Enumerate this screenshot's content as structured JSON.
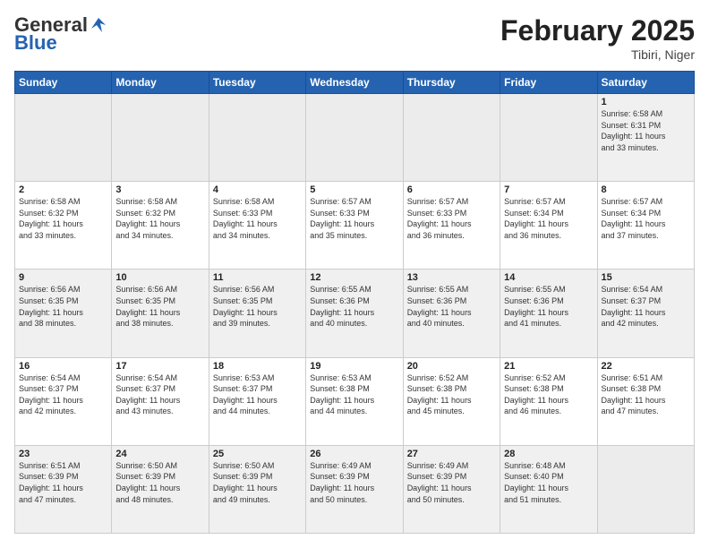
{
  "header": {
    "logo_line1": "General",
    "logo_line2": "Blue",
    "month": "February 2025",
    "location": "Tibiri, Niger"
  },
  "weekdays": [
    "Sunday",
    "Monday",
    "Tuesday",
    "Wednesday",
    "Thursday",
    "Friday",
    "Saturday"
  ],
  "weeks": [
    [
      {
        "day": "",
        "info": ""
      },
      {
        "day": "",
        "info": ""
      },
      {
        "day": "",
        "info": ""
      },
      {
        "day": "",
        "info": ""
      },
      {
        "day": "",
        "info": ""
      },
      {
        "day": "",
        "info": ""
      },
      {
        "day": "1",
        "info": "Sunrise: 6:58 AM\nSunset: 6:31 PM\nDaylight: 11 hours\nand 33 minutes."
      }
    ],
    [
      {
        "day": "2",
        "info": "Sunrise: 6:58 AM\nSunset: 6:32 PM\nDaylight: 11 hours\nand 33 minutes."
      },
      {
        "day": "3",
        "info": "Sunrise: 6:58 AM\nSunset: 6:32 PM\nDaylight: 11 hours\nand 34 minutes."
      },
      {
        "day": "4",
        "info": "Sunrise: 6:58 AM\nSunset: 6:33 PM\nDaylight: 11 hours\nand 34 minutes."
      },
      {
        "day": "5",
        "info": "Sunrise: 6:57 AM\nSunset: 6:33 PM\nDaylight: 11 hours\nand 35 minutes."
      },
      {
        "day": "6",
        "info": "Sunrise: 6:57 AM\nSunset: 6:33 PM\nDaylight: 11 hours\nand 36 minutes."
      },
      {
        "day": "7",
        "info": "Sunrise: 6:57 AM\nSunset: 6:34 PM\nDaylight: 11 hours\nand 36 minutes."
      },
      {
        "day": "8",
        "info": "Sunrise: 6:57 AM\nSunset: 6:34 PM\nDaylight: 11 hours\nand 37 minutes."
      }
    ],
    [
      {
        "day": "9",
        "info": "Sunrise: 6:56 AM\nSunset: 6:35 PM\nDaylight: 11 hours\nand 38 minutes."
      },
      {
        "day": "10",
        "info": "Sunrise: 6:56 AM\nSunset: 6:35 PM\nDaylight: 11 hours\nand 38 minutes."
      },
      {
        "day": "11",
        "info": "Sunrise: 6:56 AM\nSunset: 6:35 PM\nDaylight: 11 hours\nand 39 minutes."
      },
      {
        "day": "12",
        "info": "Sunrise: 6:55 AM\nSunset: 6:36 PM\nDaylight: 11 hours\nand 40 minutes."
      },
      {
        "day": "13",
        "info": "Sunrise: 6:55 AM\nSunset: 6:36 PM\nDaylight: 11 hours\nand 40 minutes."
      },
      {
        "day": "14",
        "info": "Sunrise: 6:55 AM\nSunset: 6:36 PM\nDaylight: 11 hours\nand 41 minutes."
      },
      {
        "day": "15",
        "info": "Sunrise: 6:54 AM\nSunset: 6:37 PM\nDaylight: 11 hours\nand 42 minutes."
      }
    ],
    [
      {
        "day": "16",
        "info": "Sunrise: 6:54 AM\nSunset: 6:37 PM\nDaylight: 11 hours\nand 42 minutes."
      },
      {
        "day": "17",
        "info": "Sunrise: 6:54 AM\nSunset: 6:37 PM\nDaylight: 11 hours\nand 43 minutes."
      },
      {
        "day": "18",
        "info": "Sunrise: 6:53 AM\nSunset: 6:37 PM\nDaylight: 11 hours\nand 44 minutes."
      },
      {
        "day": "19",
        "info": "Sunrise: 6:53 AM\nSunset: 6:38 PM\nDaylight: 11 hours\nand 44 minutes."
      },
      {
        "day": "20",
        "info": "Sunrise: 6:52 AM\nSunset: 6:38 PM\nDaylight: 11 hours\nand 45 minutes."
      },
      {
        "day": "21",
        "info": "Sunrise: 6:52 AM\nSunset: 6:38 PM\nDaylight: 11 hours\nand 46 minutes."
      },
      {
        "day": "22",
        "info": "Sunrise: 6:51 AM\nSunset: 6:38 PM\nDaylight: 11 hours\nand 47 minutes."
      }
    ],
    [
      {
        "day": "23",
        "info": "Sunrise: 6:51 AM\nSunset: 6:39 PM\nDaylight: 11 hours\nand 47 minutes."
      },
      {
        "day": "24",
        "info": "Sunrise: 6:50 AM\nSunset: 6:39 PM\nDaylight: 11 hours\nand 48 minutes."
      },
      {
        "day": "25",
        "info": "Sunrise: 6:50 AM\nSunset: 6:39 PM\nDaylight: 11 hours\nand 49 minutes."
      },
      {
        "day": "26",
        "info": "Sunrise: 6:49 AM\nSunset: 6:39 PM\nDaylight: 11 hours\nand 50 minutes."
      },
      {
        "day": "27",
        "info": "Sunrise: 6:49 AM\nSunset: 6:39 PM\nDaylight: 11 hours\nand 50 minutes."
      },
      {
        "day": "28",
        "info": "Sunrise: 6:48 AM\nSunset: 6:40 PM\nDaylight: 11 hours\nand 51 minutes."
      },
      {
        "day": "",
        "info": ""
      }
    ]
  ]
}
